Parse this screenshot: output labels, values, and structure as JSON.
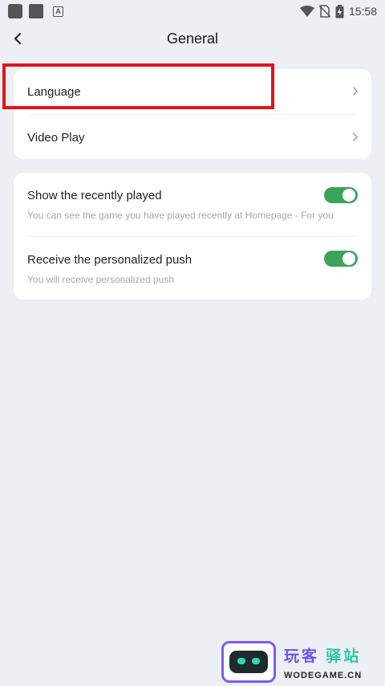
{
  "status_bar": {
    "time": "15:58",
    "icons": [
      "app-icon",
      "clipboard-icon",
      "a-icon",
      "wifi-icon",
      "no-sim-icon",
      "battery-charging-icon"
    ]
  },
  "header": {
    "title": "General",
    "back_icon": "chevron-left-icon"
  },
  "nav_items": [
    {
      "label": "Language"
    },
    {
      "label": "Video Play"
    }
  ],
  "settings": [
    {
      "title": "Show the recently played",
      "description": "You can see the game you have played recently at Homepage - For you",
      "enabled": true
    },
    {
      "title": "Receive the personalized push",
      "description": "You will receive personalized push",
      "enabled": true
    }
  ],
  "colors": {
    "background": "#eceff4",
    "card": "#ffffff",
    "toggle_on": "#3aa55a",
    "highlight": "#e0141b"
  },
  "watermark": {
    "cn_part1": "玩客",
    "cn_part2": "驿站",
    "en": "WODEGAME.CN"
  }
}
